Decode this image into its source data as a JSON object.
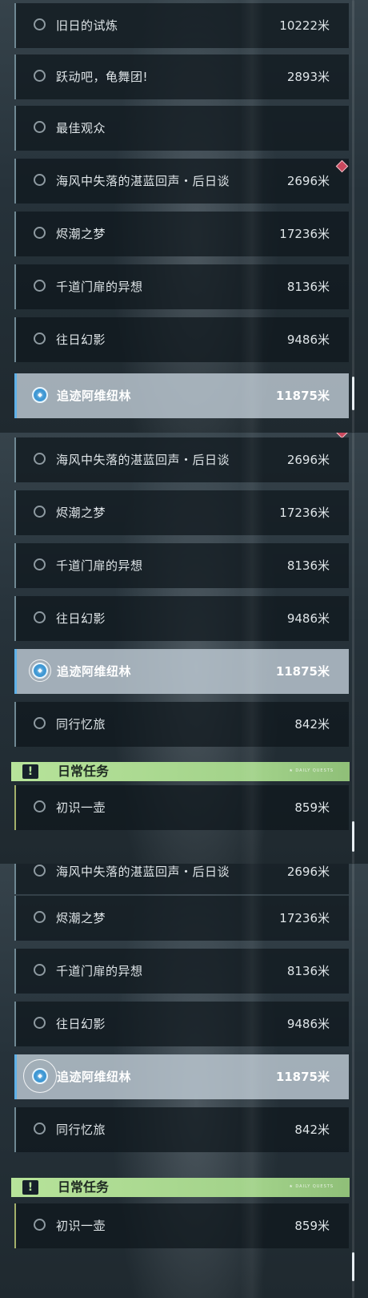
{
  "section_header": {
    "label": "日常任务",
    "icon": "exclamation-icon",
    "tag": "★ DAILY QUESTS",
    "color": "#b7e39a"
  },
  "accent_color": "#5fb1e8",
  "panel1": {
    "items": [
      {
        "name": "旧日的试炼",
        "distance": "10222米"
      },
      {
        "name": "跃动吧，龟舞团!",
        "distance": "2893米"
      },
      {
        "name": "最佳观众",
        "distance": ""
      },
      {
        "name": "海风中失落的湛蓝回声・后日谈",
        "distance": "2696米"
      },
      {
        "name": "烬潮之梦",
        "distance": "17236米"
      },
      {
        "name": "千道门扉的异想",
        "distance": "8136米"
      },
      {
        "name": "往日幻影",
        "distance": "9486米"
      },
      {
        "name": "追迹阿维纽林",
        "distance": "11875米"
      }
    ]
  },
  "panel2": {
    "items": [
      {
        "name": "海风中失落的湛蓝回声・后日谈",
        "distance": "2696米"
      },
      {
        "name": "烬潮之梦",
        "distance": "17236米"
      },
      {
        "name": "千道门扉的异想",
        "distance": "8136米"
      },
      {
        "name": "往日幻影",
        "distance": "9486米"
      },
      {
        "name": "追迹阿维纽林",
        "distance": "11875米"
      },
      {
        "name": "同行忆旅",
        "distance": "842米"
      }
    ],
    "daily_items": [
      {
        "name": "初识一壶",
        "distance": "859米"
      }
    ]
  },
  "panel3": {
    "items": [
      {
        "name": "海风中失落的湛蓝回声・后日谈",
        "distance": "2696米"
      },
      {
        "name": "烬潮之梦",
        "distance": "17236米"
      },
      {
        "name": "千道门扉的异想",
        "distance": "8136米"
      },
      {
        "name": "往日幻影",
        "distance": "9486米"
      },
      {
        "name": "追迹阿维纽林",
        "distance": "11875米"
      },
      {
        "name": "同行忆旅",
        "distance": "842米"
      }
    ],
    "daily_items": [
      {
        "name": "初识一壶",
        "distance": "859米"
      }
    ]
  }
}
